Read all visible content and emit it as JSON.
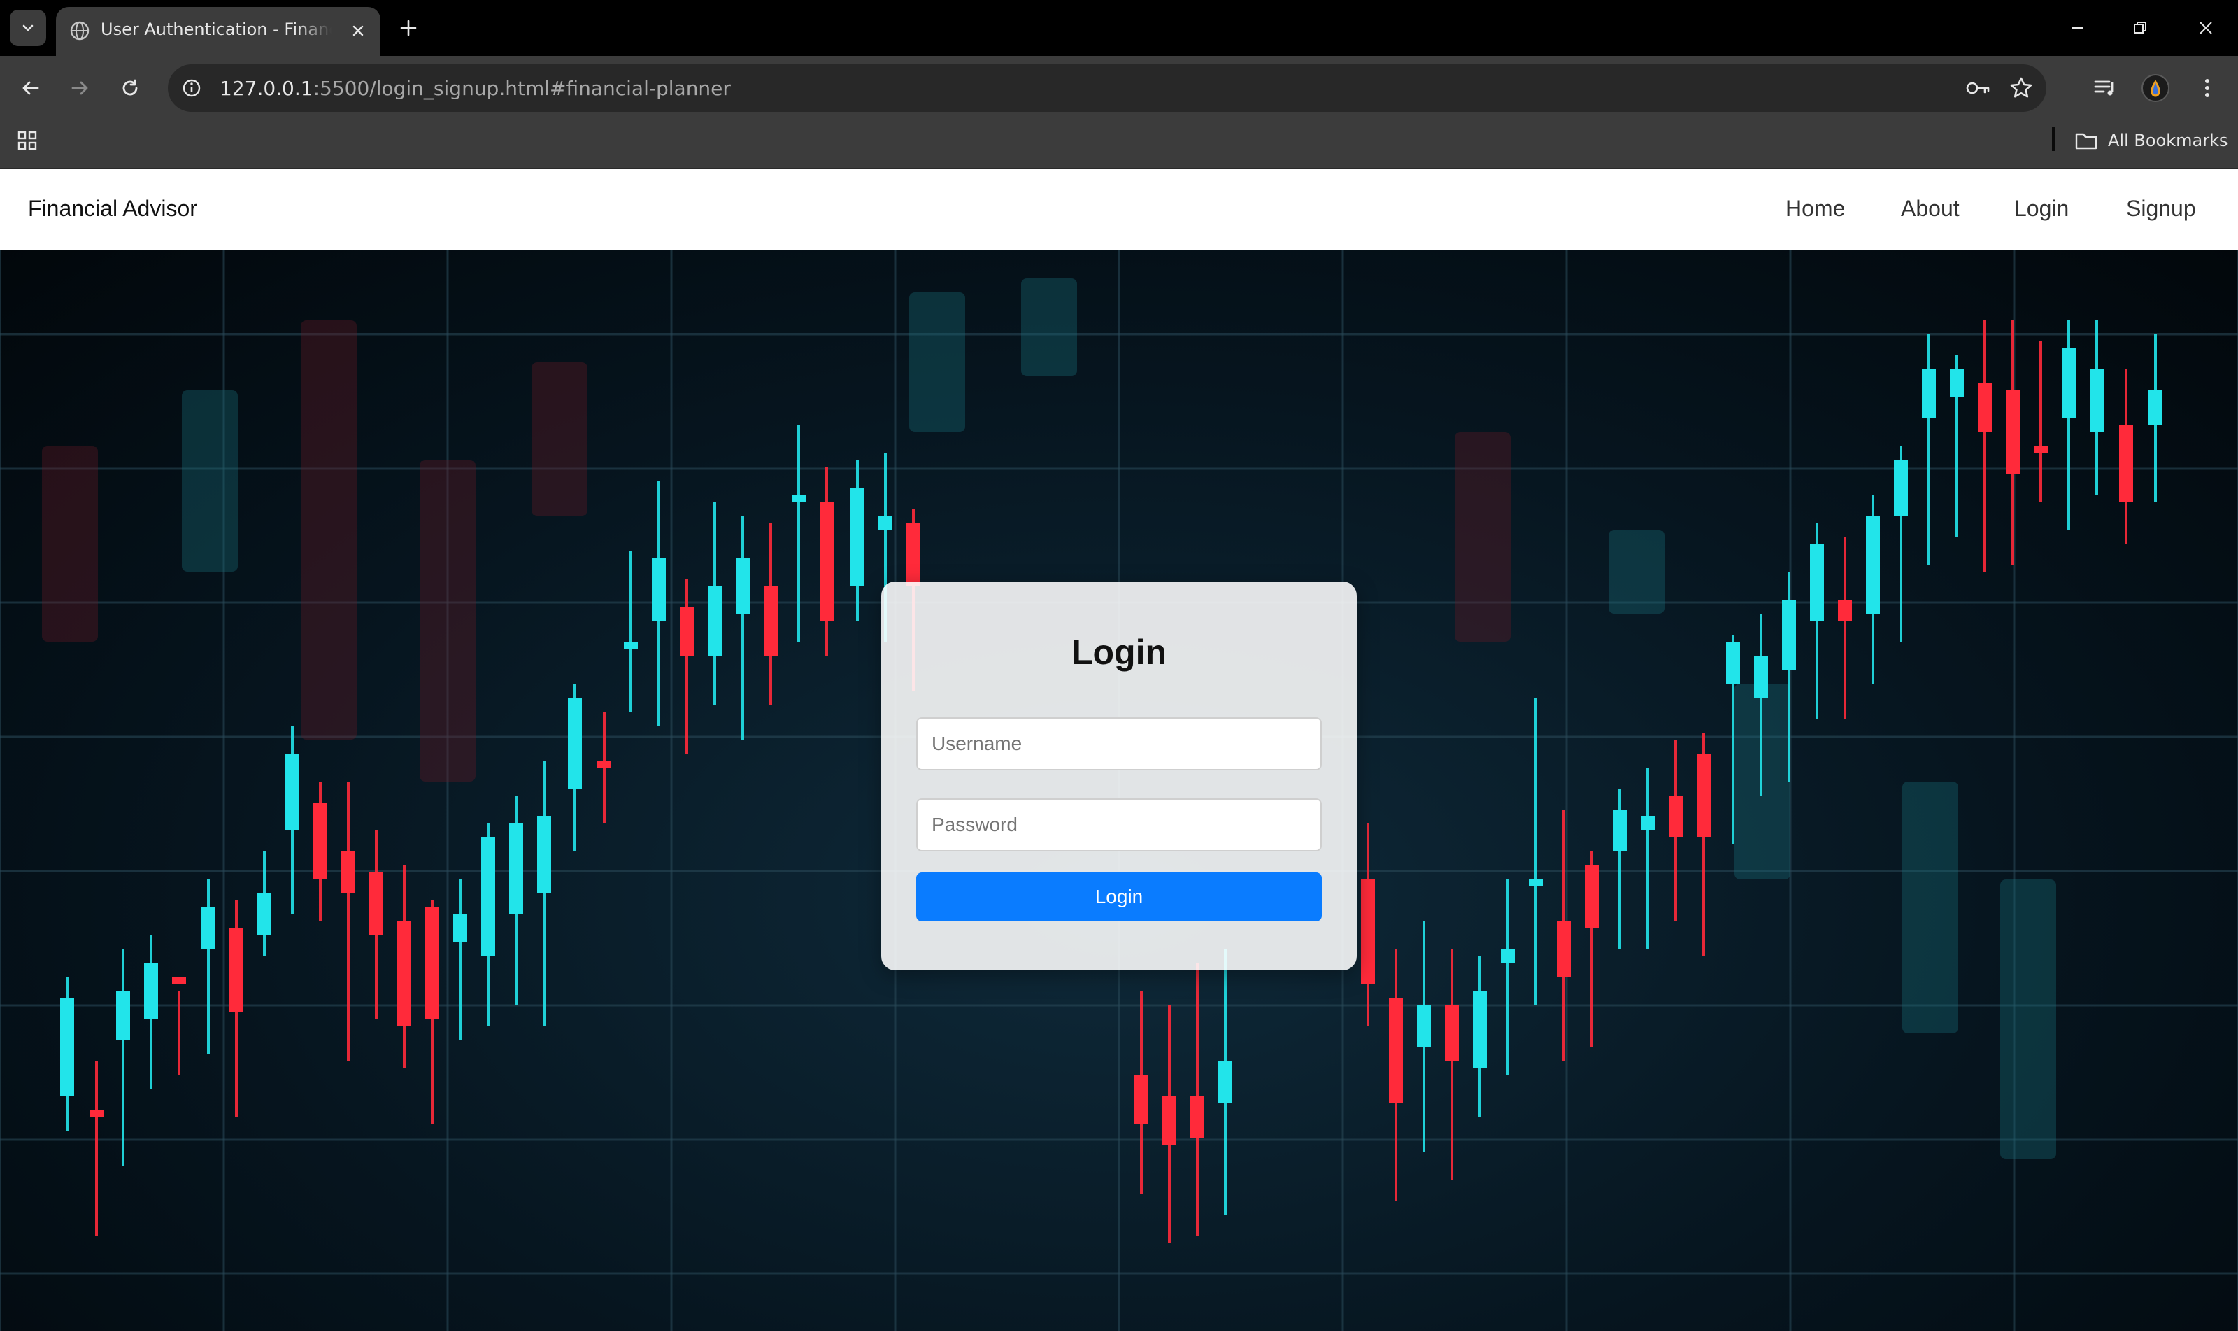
{
  "browser": {
    "tab_title": "User Authentication - Financial Advisor",
    "url_host": "127.0.0.1",
    "url_path": ":5500/login_signup.html#financial-planner",
    "all_bookmarks_label": "All Bookmarks"
  },
  "site": {
    "brand": "Financial Advisor",
    "nav": [
      "Home",
      "About",
      "Login",
      "Signup"
    ]
  },
  "login": {
    "title": "Login",
    "username_placeholder": "Username",
    "password_placeholder": "Password",
    "button_label": "Login"
  },
  "colors": {
    "primary_button": "#0a7cff",
    "candle_up": "#22e4ea",
    "candle_down": "#ff2a3a"
  }
}
